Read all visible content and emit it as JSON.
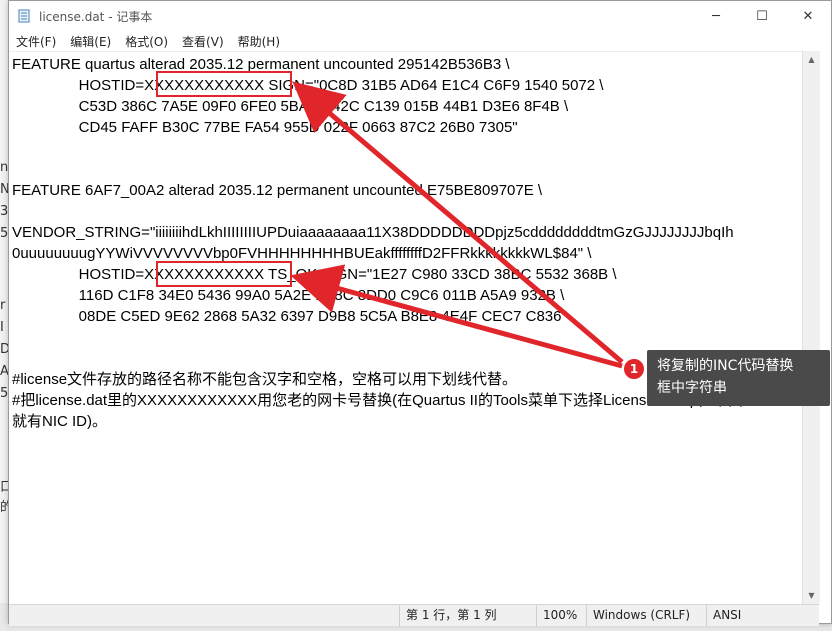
{
  "window": {
    "title": "license.dat - 记事本",
    "minimize_icon": "─",
    "maximize_icon": "☐",
    "close_icon": "✕"
  },
  "menu": [
    "文件(F)",
    "编辑(E)",
    "格式(O)",
    "查看(V)",
    "帮助(H)"
  ],
  "editor_lines": [
    "FEATURE quartus alterad 2035.12 permanent uncounted 295142B536B3 \\",
    "                HOSTID=XXXXXXXXXXXX SIGN=\"0C8D 31B5 AD64 E1C4 C6F9 1540 5072 \\",
    "                C53D 386C 7A5E 09F0 6FE0 5BAB A42C C139 015B 44B1 D3E6 8F4B \\",
    "                CD45 FAFF B30C 77BE FA54 955D 022F 0663 87C2 26B0 7305\"",
    "",
    "",
    "FEATURE 6AF7_00A2 alterad 2035.12 permanent uncounted E75BE809707E \\",
    "",
    "VENDOR_STRING=\"iiiiiiiihdLkhIIIIIIIIUPDuiaaaaaaaa11X38DDDDDDDDpjz5cddddddddtmGzGJJJJJJJJbqIh",
    "0uuuuuuuugYYWiVVVVVVVVbp0FVHHHHHHHHBUEakffffffffD2FFRkkkkkkkkWL$84\" \\",
    "                HOSTID=XXXXXXXXXXXX TS_OK SIGN=\"1E27 C980 33CD 38BC 5532 368B \\",
    "                116D C1F8 34E0 5436 99A0 5A2E 1C8C 8DD0 C9C6 011B A5A9 932B \\",
    "                08DE C5ED 9E62 2868 5A32 6397 D9B8 5C5A B8E8 4E4F CEC7 C836\"",
    "",
    "",
    "#license文件存放的路径名称不能包含汉字和空格，空格可以用下划线代替。",
    "#把license.dat里的XXXXXXXXXXXX用您老的网卡号替换(在Quartus II的Tools菜单下选择License Setup，下面",
    "就有NIC ID)。"
  ],
  "status": {
    "position": "第 1 行，第 1 列",
    "zoom": "100%",
    "line_ending": "Windows (CRLF)",
    "encoding": "ANSI"
  },
  "annotation": {
    "number": "1",
    "text_line1": "将复制的INC代码替换",
    "text_line2": "框中字符串"
  },
  "background_fragments": [
    "n",
    "N",
    "3",
    "5",
    "r",
    "I",
    "D",
    "A",
    "5",
    "口",
    "的"
  ],
  "colors": {
    "highlight": "#e0262b",
    "tooltip_bg": "#4a4a4a"
  }
}
